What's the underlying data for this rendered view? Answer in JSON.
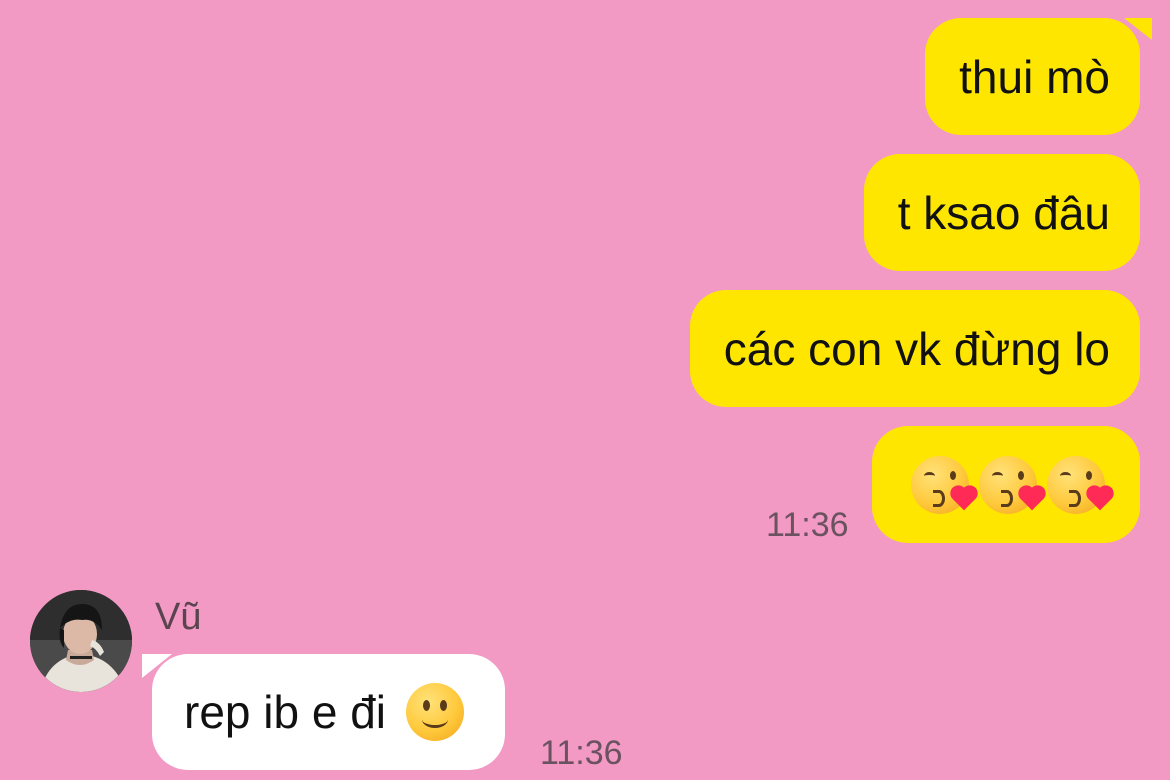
{
  "messages_out": [
    {
      "text": "thui mò"
    },
    {
      "text": "t ksao đâu"
    },
    {
      "text": "các con vk đừng lo"
    },
    {
      "emojis": [
        "kissing-face-with-heart-icon",
        "kissing-face-with-heart-icon",
        "kissing-face-with-heart-icon"
      ],
      "time": "11:36"
    }
  ],
  "incoming": {
    "sender": "Vũ",
    "text": "rep ib e đi",
    "emoji": "slightly-smiling-face-icon",
    "time": "11:36"
  },
  "colors": {
    "background": "#f29ac4",
    "outgoing_bubble": "#ffe600",
    "incoming_bubble": "#ffffff"
  }
}
